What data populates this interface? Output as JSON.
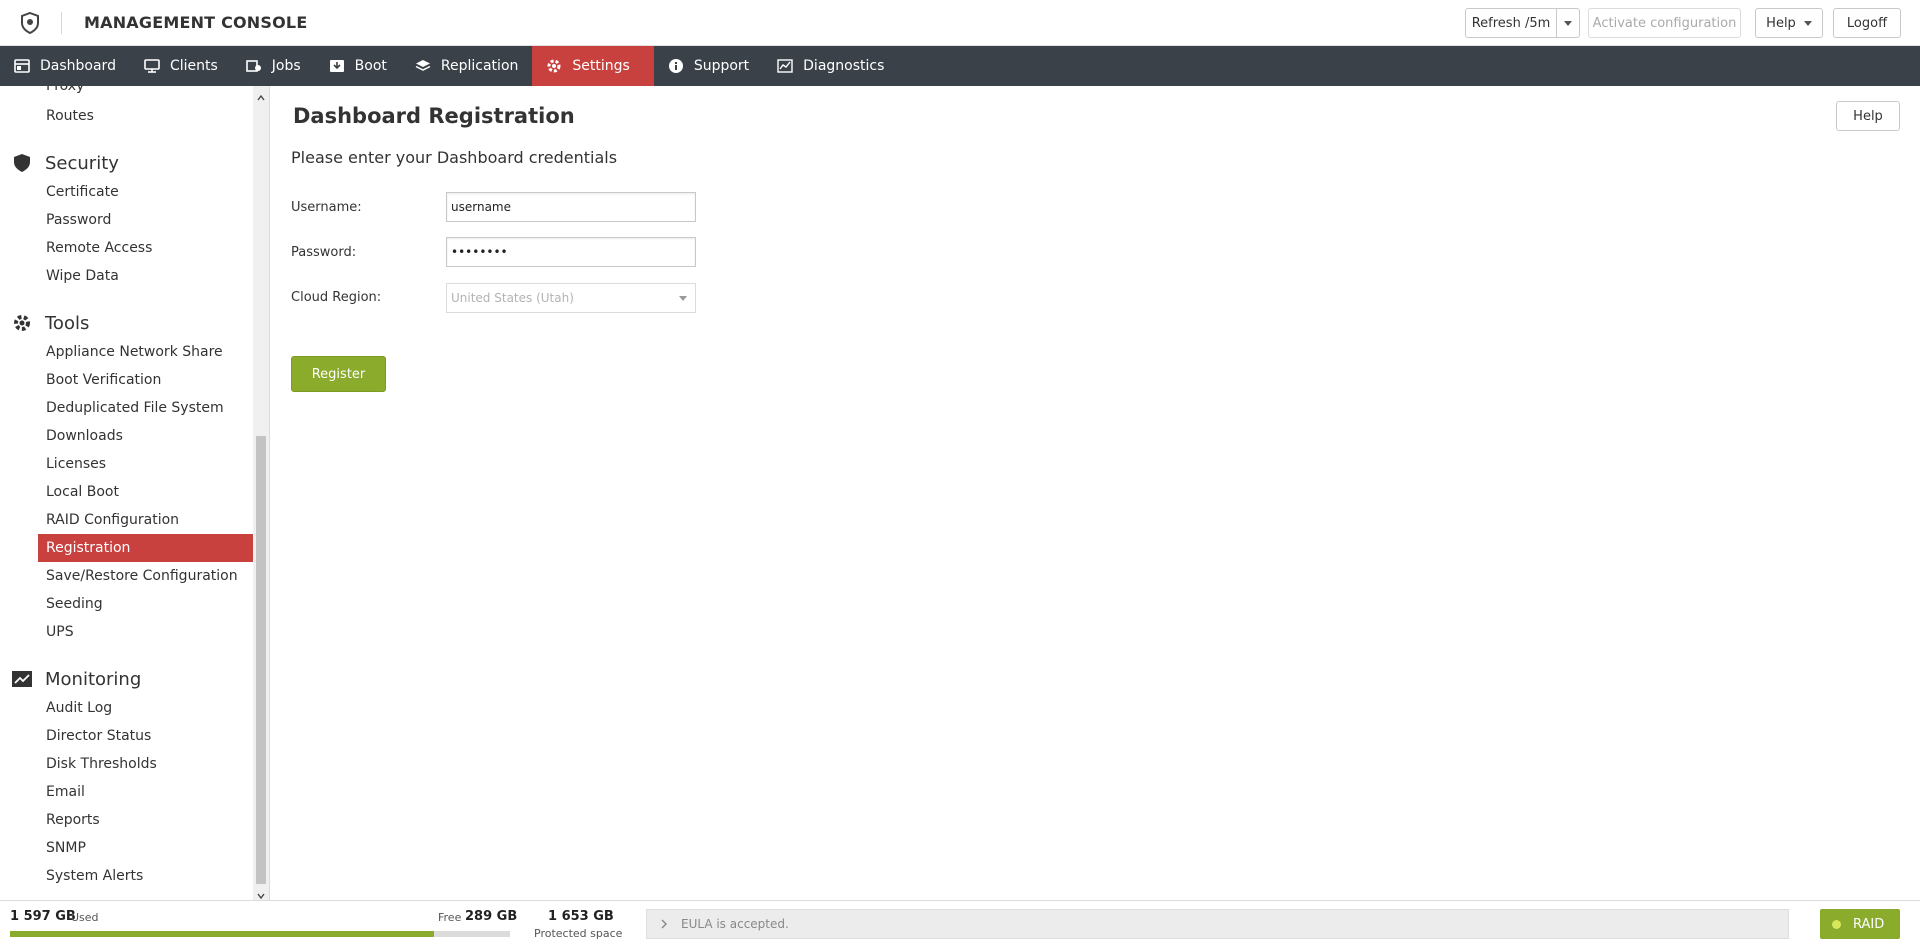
{
  "header": {
    "title": "MANAGEMENT CONSOLE",
    "refresh_label": "Refresh /5m",
    "activate_label": "Activate configuration",
    "help_label": "Help",
    "logoff_label": "Logoff"
  },
  "nav": {
    "items": [
      {
        "label": "Dashboard",
        "icon": "dashboard-icon"
      },
      {
        "label": "Clients",
        "icon": "monitor-icon"
      },
      {
        "label": "Jobs",
        "icon": "jobs-icon"
      },
      {
        "label": "Boot",
        "icon": "boot-icon"
      },
      {
        "label": "Replication",
        "icon": "layers-icon"
      },
      {
        "label": "Settings",
        "icon": "gear-icon",
        "active": true
      },
      {
        "label": "Support",
        "icon": "info-icon"
      },
      {
        "label": "Diagnostics",
        "icon": "chart-icon"
      }
    ]
  },
  "sidebar": {
    "network_items": [
      "Proxy",
      "Routes"
    ],
    "security": {
      "label": "Security",
      "icon": "shield-icon",
      "items": [
        "Certificate",
        "Password",
        "Remote Access",
        "Wipe Data"
      ]
    },
    "tools": {
      "label": "Tools",
      "icon": "tools-gear-icon",
      "items": [
        "Appliance Network Share",
        "Boot Verification",
        "Deduplicated File System",
        "Downloads",
        "Licenses",
        "Local Boot",
        "RAID Configuration",
        "Registration",
        "Save/Restore Configuration",
        "Seeding",
        "UPS"
      ],
      "active_item": "Registration"
    },
    "monitoring": {
      "label": "Monitoring",
      "icon": "line-chart-icon",
      "items": [
        "Audit Log",
        "Director Status",
        "Disk Thresholds",
        "Email",
        "Reports",
        "SNMP",
        "System Alerts"
      ]
    }
  },
  "main": {
    "title": "Dashboard Registration",
    "help_label": "Help",
    "subtitle": "Please enter your Dashboard credentials",
    "username_label": "Username:",
    "username_value": "username",
    "password_label": "Password:",
    "password_value": "password",
    "region_label": "Cloud Region:",
    "region_value": "United States (Utah)",
    "register_label": "Register"
  },
  "footer": {
    "used_value": "1 597 GB",
    "used_label": "Used",
    "free_label": "Free",
    "free_value": "289 GB",
    "usage_fraction": 0.847,
    "protected_value": "1 653 GB",
    "protected_label": "Protected space",
    "eula_text": "EULA is accepted.",
    "raid_label": "RAID",
    "colors": {
      "accent": "#c8413e",
      "success": "#8aab2c",
      "nav_bg": "#3a4149"
    }
  }
}
